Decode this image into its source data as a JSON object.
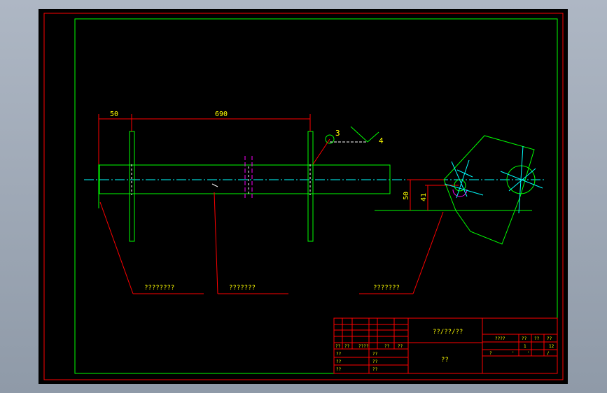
{
  "colors": {
    "frame": "#00ff00",
    "border": "#ff0000",
    "centerline": "#00ffff",
    "dimension": "#ff0000",
    "text": "#ffff00",
    "tick": "#ffffff",
    "flange": "#ff00ff"
  },
  "drawing": {
    "dims": {
      "left": "50",
      "span": "690",
      "h1": "50",
      "h2": "41"
    },
    "balloon": {
      "number": "3",
      "ref": "4"
    },
    "notes": {
      "n1": "????????",
      "n2": "???????",
      "n3": "???????"
    }
  },
  "title_block": {
    "title": "??/??/??",
    "name": "??",
    "left_row": [
      "??",
      "??",
      "????",
      "??",
      "??"
    ],
    "left_rows2": [
      "??",
      "??"
    ],
    "left_rows3": [
      "??",
      "??"
    ],
    "left_rows4": [
      "??",
      "??"
    ],
    "right_header": [
      "????",
      "??",
      "??",
      "??"
    ],
    "right_values": [
      "1",
      "12"
    ],
    "right_bottom": [
      "?",
      "'",
      "'",
      "/"
    ]
  }
}
